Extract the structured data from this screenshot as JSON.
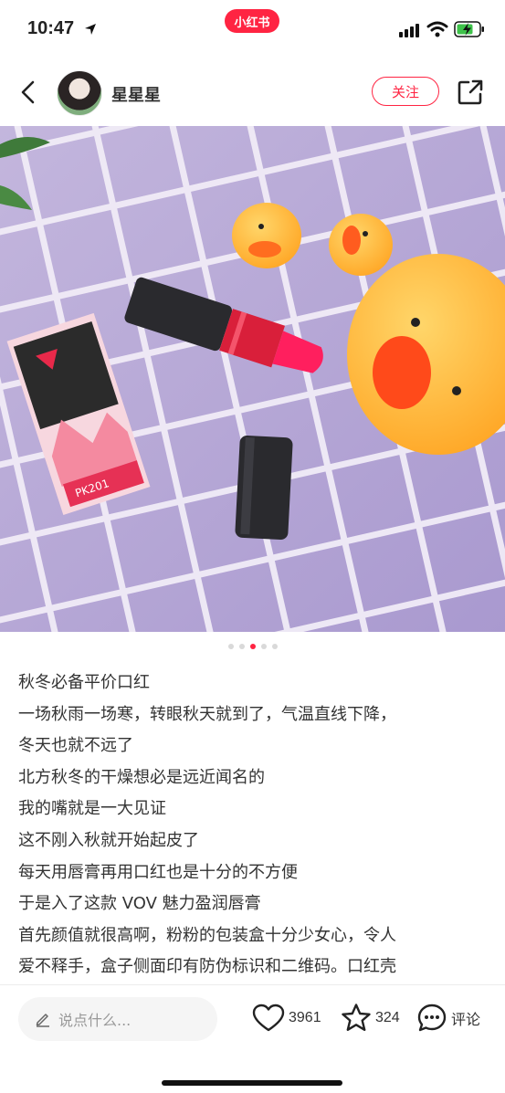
{
  "status_bar": {
    "time": "10:47",
    "app_badge": "小红书"
  },
  "header": {
    "username": "星星星",
    "follow_label": "关注"
  },
  "gallery": {
    "total": 5,
    "active_index": 2
  },
  "post": {
    "lines": [
      "秋冬必备平价口红",
      "一场秋雨一场寒，转眼秋天就到了，气温直线下降，",
      "冬天也就不远了",
      "北方秋冬的干燥想必是远近闻名的",
      "我的嘴就是一大见证",
      "这不刚入秋就开始起皮了",
      "每天用唇膏再用口红也是十分的不方便",
      "于是入了这款 VOV 魅力盈润唇膏",
      "首先颜值就很高啊，粉粉的包装盒十分少女心，令人",
      "爱不释手，盒子侧面印有防伪标识和二维码。口红壳"
    ]
  },
  "photo": {
    "box_code": "PK201"
  },
  "bottom_bar": {
    "comment_placeholder": "说点什么...",
    "likes": "3961",
    "collects": "324",
    "comment_label": "评论"
  },
  "colors": {
    "accent": "#ff2442",
    "background": "#b8a6d8"
  }
}
